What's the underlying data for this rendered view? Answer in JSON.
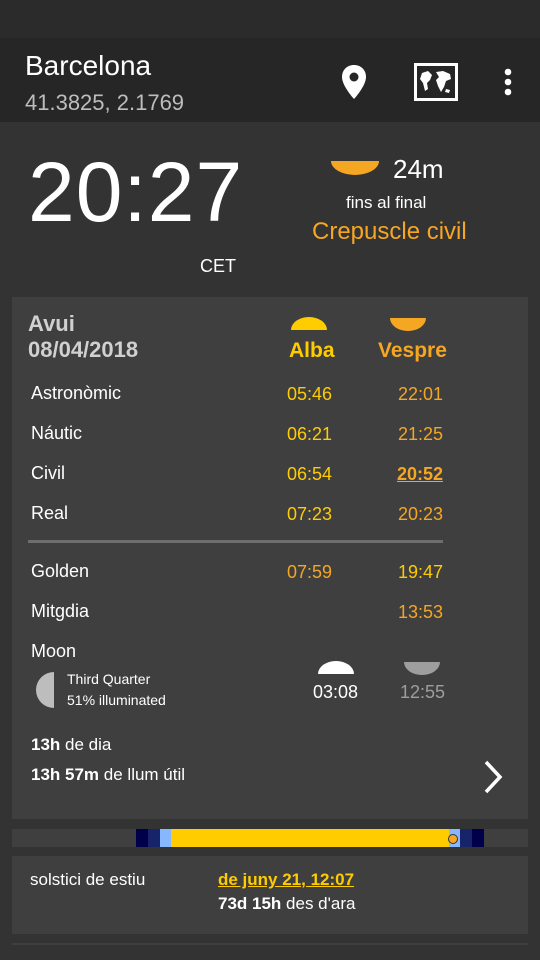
{
  "header": {
    "location_name": "Barcelona",
    "coordinates": "41.3825, 2.1769",
    "icons": [
      "location-pin-icon",
      "world-map-icon",
      "more-vert-icon"
    ]
  },
  "now": {
    "time": "20:27",
    "timezone": "CET",
    "remaining": "24m",
    "until_label": "fins al final",
    "phase_name": "Crepuscle civil"
  },
  "today": {
    "heading": "Avui",
    "date": "08/04/2018",
    "col_rise": "Alba",
    "col_set": "Vespre",
    "rows": [
      {
        "label": "Astronòmic",
        "rise": "05:46",
        "set": "22:01"
      },
      {
        "label": "Náutic",
        "rise": "06:21",
        "set": "21:25"
      },
      {
        "label": "Civil",
        "rise": "06:54",
        "set": "20:52"
      },
      {
        "label": "Real",
        "rise": "07:23",
        "set": "20:23"
      }
    ],
    "golden": {
      "label": "Golden",
      "rise": "07:59",
      "set": "19:47"
    },
    "noon": {
      "label": "Mitgdia",
      "value": "13:53"
    },
    "moon": {
      "label": "Moon",
      "phase": "Third Quarter",
      "illumination": "51% illuminated",
      "rise": "03:08",
      "set": "12:55"
    },
    "day_length_value": "13h",
    "day_length_text": "de dia",
    "usable_value": "13h 57m",
    "usable_text": "de llum útil"
  },
  "next_event": {
    "name": "solstici de estiu",
    "date": "de juny 21, 12:07",
    "relative_value": "73d 15h",
    "relative_text": "des d'ara"
  },
  "colors": {
    "background": "#333333",
    "card": "#3f3f3f",
    "appbar": "#262626",
    "sunrise_yellow": "#ffcc00",
    "sunset_orange": "#f5a623",
    "night": "#00004a",
    "twilight": "#87b8ff"
  }
}
